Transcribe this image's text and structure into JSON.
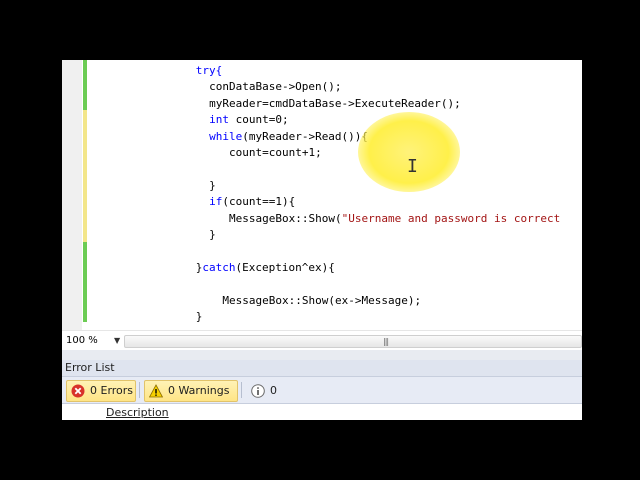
{
  "editor": {
    "lines": [
      {
        "indent": 12,
        "parts": [
          {
            "t": "try{",
            "k": "kw"
          }
        ]
      },
      {
        "indent": 14,
        "parts": [
          {
            "t": "conDataBase->Open();"
          }
        ]
      },
      {
        "indent": 14,
        "parts": [
          {
            "t": "myReader=cmdDataBase->ExecuteReader();"
          }
        ]
      },
      {
        "indent": 14,
        "parts": [
          {
            "t": "int",
            "k": "kw"
          },
          {
            "t": " count=0;"
          }
        ]
      },
      {
        "indent": 14,
        "parts": [
          {
            "t": "while",
            "k": "kw"
          },
          {
            "t": "(myReader->Read()){"
          }
        ]
      },
      {
        "indent": 17,
        "parts": [
          {
            "t": "count=count+1;"
          }
        ]
      },
      {
        "indent": 0,
        "parts": []
      },
      {
        "indent": 14,
        "parts": [
          {
            "t": "}"
          }
        ]
      },
      {
        "indent": 14,
        "parts": [
          {
            "t": "if",
            "k": "kw"
          },
          {
            "t": "(count==1){"
          }
        ]
      },
      {
        "indent": 17,
        "parts": [
          {
            "t": "MessageBox::Show("
          },
          {
            "t": "\"Username and password is correct",
            "k": "str"
          }
        ]
      },
      {
        "indent": 14,
        "parts": [
          {
            "t": "}"
          }
        ]
      },
      {
        "indent": 0,
        "parts": []
      },
      {
        "indent": 12,
        "parts": [
          {
            "t": "}"
          },
          {
            "t": "catch",
            "k": "kw"
          },
          {
            "t": "(Exception^ex){"
          }
        ]
      },
      {
        "indent": 0,
        "parts": []
      },
      {
        "indent": 16,
        "parts": [
          {
            "t": "MessageBox::Show(ex->Message);"
          }
        ]
      },
      {
        "indent": 12,
        "parts": [
          {
            "t": "}"
          }
        ]
      }
    ]
  },
  "zoom": {
    "value": "100 %"
  },
  "error_list": {
    "title": "Error List",
    "errors_label": "0 Errors",
    "warnings_label": "0 Warnings",
    "messages_label": "0 Messages",
    "column_description": "Description"
  }
}
